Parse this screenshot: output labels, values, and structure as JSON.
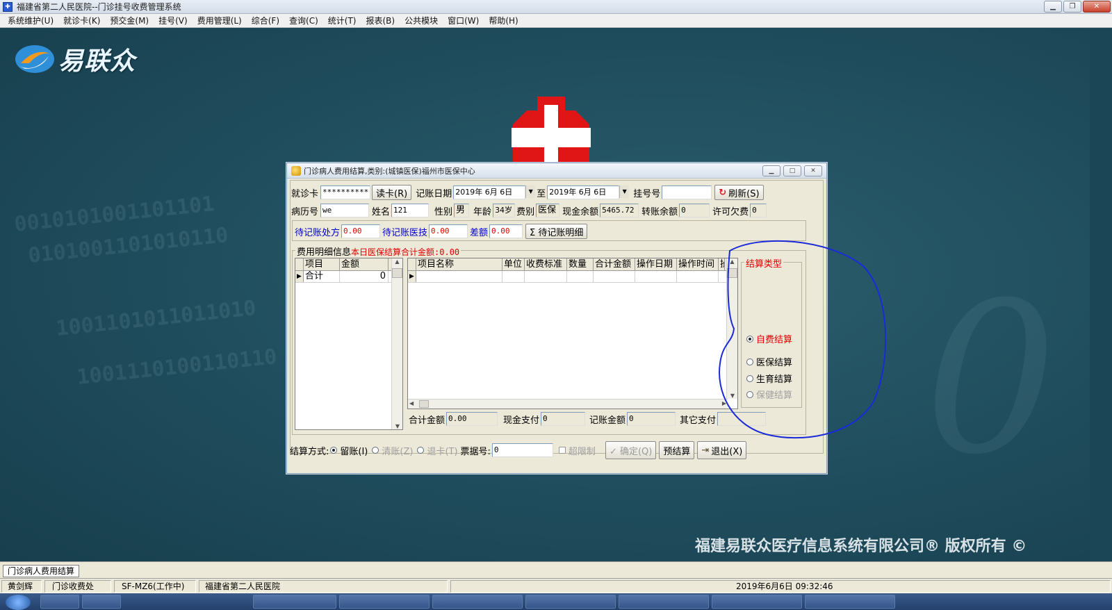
{
  "window": {
    "title": "福建省第二人民医院--门诊挂号收费管理系统",
    "app_icon": "hospital-app-icon"
  },
  "menu": [
    "系统维护(U)",
    "就诊卡(K)",
    "预交金(M)",
    "挂号(V)",
    "费用管理(L)",
    "综合(F)",
    "查询(C)",
    "统计(T)",
    "报表(B)",
    "公共模块",
    "窗口(W)",
    "帮助(H)"
  ],
  "desktop": {
    "logo_text": "易联众",
    "copyright": "福建易联众医疗信息系统有限公司® 版权所有 ©"
  },
  "dialog": {
    "title": "门诊病人费用结算,类别:(城镇医保)福州市医保中心",
    "card_label": "就诊卡",
    "card_value": "**********",
    "read_card_button": "读卡(R)",
    "date_label": "记账日期",
    "date_from": "2019年 6月 6日",
    "date_to_label": "至",
    "date_to": "2019年 6月 6日",
    "reg_no_label": "挂号号",
    "reg_no_value": "",
    "refresh_button": "刷新(S)",
    "record_no_label": "病历号",
    "record_no_value": "we",
    "name_label": "姓名",
    "name_value": "121",
    "gender_label": "性别",
    "gender_value": "男",
    "age_label": "年龄",
    "age_value": "34岁",
    "fee_type_label": "费别",
    "fee_type_value": "医保",
    "cash_balance_label": "现金余额",
    "cash_balance_value": "5465.72",
    "transfer_balance_label": "转账余额",
    "transfer_balance_value": "0",
    "allow_debt_label": "许可欠费",
    "allow_debt_value": "0",
    "pending_rx_label": "待记账处方",
    "pending_rx_value": "0.00",
    "pending_tech_label": "待记账医技",
    "pending_tech_value": "0.00",
    "diff_label": "差额",
    "diff_value": "0.00",
    "pending_detail_button": "Σ 待记账明细",
    "detail_group_title": "费用明细信息",
    "detail_group_note": "本日医保结算合计金额:0.00",
    "left_grid": {
      "columns": [
        "项目",
        "金额"
      ],
      "rows": [
        [
          "合计",
          "0"
        ]
      ]
    },
    "right_grid": {
      "columns": [
        "项目名称",
        "单位",
        "收费标准",
        "数量",
        "合计金额",
        "操作日期",
        "操作时间",
        "操"
      ]
    },
    "settle_type_title": "结算类型",
    "settle_types": [
      {
        "label": "自费结算",
        "selected": true,
        "enabled": true
      },
      {
        "label": "医保结算",
        "selected": false,
        "enabled": true
      },
      {
        "label": "生育结算",
        "selected": false,
        "enabled": true
      },
      {
        "label": "保健结算",
        "selected": false,
        "enabled": false
      }
    ],
    "total_label": "合计金额",
    "total_value": "0.00",
    "cash_pay_label": "现金支付",
    "cash_pay_value": "0",
    "account_amount_label": "记账金额",
    "account_amount_value": "0",
    "other_pay_label": "其它支付",
    "other_pay_value": "",
    "settle_method_label": "结算方式:",
    "methods": [
      {
        "label": "留账(I)",
        "selected": true,
        "enabled": true
      },
      {
        "label": "清账(Z)",
        "selected": false,
        "enabled": false
      },
      {
        "label": "退卡(T)",
        "selected": false,
        "enabled": false
      }
    ],
    "ticket_no_label": "票据号:",
    "ticket_no_value": "0",
    "limit_label": "超限制",
    "confirm_button": "✓ 确定(Q)",
    "pre_settle_button": "预结算",
    "exit_button": "退出(X)"
  },
  "mdi_tab": "门诊病人费用结算",
  "status": {
    "user": "黄剑辉",
    "dept": "门诊收费处",
    "machine": "SF-MZ6(工作中)",
    "hospital": "福建省第二人民医院",
    "datetime": "2019年6月6日  09:32:46"
  }
}
